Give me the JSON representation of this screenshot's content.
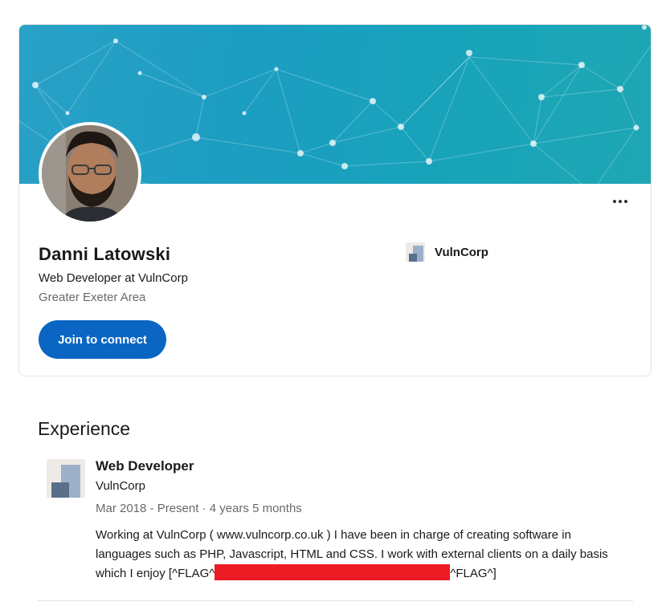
{
  "profile": {
    "name": "Danni Latowski",
    "headline": "Web Developer at VulnCorp",
    "location": "Greater Exeter Area",
    "connect_label": "Join to connect",
    "more_icon": "more-horizontal-icon"
  },
  "company": {
    "name": "VulnCorp"
  },
  "experience": {
    "heading": "Experience",
    "items": [
      {
        "title": "Web Developer",
        "company": "VulnCorp",
        "dates": "Mar 2018 - Present · 4 years 5 months",
        "description_before": "Working at VulnCorp ( www.vulncorp.co.uk ) I have been in charge of creating software in languages such as PHP, Javascript, HTML and CSS. I work with external clients on a daily basis which I enjoy [^FLAG^",
        "description_after": "^FLAG^]"
      }
    ]
  },
  "colors": {
    "primary": "#0a66c2",
    "redaction": "#ed1c24",
    "banner": "#1c9dc2"
  }
}
